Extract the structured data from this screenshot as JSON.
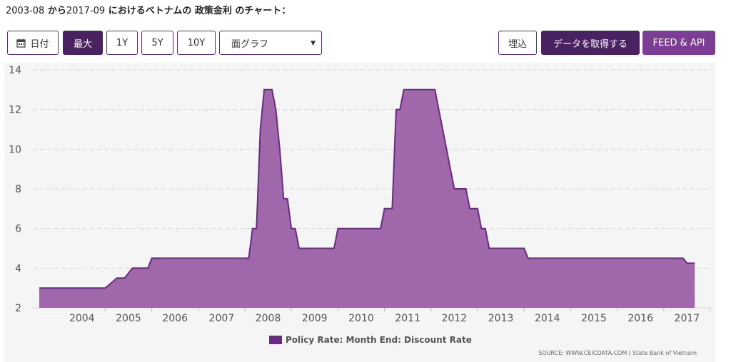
{
  "title": {
    "start": "2003-08",
    "from_word": " から",
    "end": "2017-09",
    "rest": " におけるベトナムの 政策金利 のチャート："
  },
  "toolbar": {
    "date_label": "日付",
    "max_label": "最大",
    "one_y_label": "1Y",
    "five_y_label": "5Y",
    "ten_y_label": "10Y",
    "chart_type_value": "面グラフ",
    "embed_label": "埋込",
    "get_data_label": "データを取得する",
    "feed_api_label": "FEED & API"
  },
  "colors": {
    "area_fill": "#9c5fa6",
    "area_stroke": "#6a2c80",
    "active_button": "#4a2161",
    "accent_button": "#7c3e94"
  },
  "icons": {
    "date": "calendar-icon",
    "select": "caret-down-icon"
  },
  "chart_data": {
    "type": "area",
    "title": "",
    "xlabel": "",
    "ylabel": "",
    "ylim": [
      2,
      14
    ],
    "y_ticks": [
      "2",
      "4",
      "6",
      "8",
      "10",
      "12",
      "14"
    ],
    "x_ticks": [
      "2004",
      "2005",
      "2006",
      "2007",
      "2008",
      "2009",
      "2010",
      "2011",
      "2012",
      "2013",
      "2014",
      "2015",
      "2016",
      "2017"
    ],
    "grid": true,
    "legend_position": "bottom-center",
    "series": [
      {
        "name": "Policy Rate: Month End: Discount Rate",
        "x": [
          "2003-08",
          "2004-12",
          "2005-01",
          "2005-04",
          "2005-06",
          "2005-08",
          "2005-10",
          "2005-12",
          "2006-01",
          "2007-12",
          "2008-01",
          "2008-02",
          "2008-03",
          "2008-04",
          "2008-05",
          "2008-06",
          "2008-07",
          "2008-08",
          "2008-09",
          "2008-10",
          "2008-11",
          "2008-12",
          "2009-01",
          "2009-02",
          "2009-03",
          "2009-12",
          "2010-01",
          "2010-02",
          "2010-11",
          "2010-12",
          "2011-01",
          "2011-02",
          "2011-03",
          "2011-04",
          "2011-05",
          "2011-06",
          "2011-07",
          "2011-12",
          "2012-01",
          "2012-02",
          "2012-03",
          "2012-04",
          "2012-05",
          "2012-06",
          "2012-07",
          "2012-08",
          "2012-09",
          "2012-10",
          "2012-11",
          "2012-12",
          "2013-01",
          "2013-02",
          "2013-03",
          "2013-04",
          "2013-05",
          "2013-06",
          "2013-07",
          "2014-01",
          "2014-02",
          "2014-03",
          "2014-04",
          "2017-06",
          "2017-07",
          "2017-09"
        ],
        "values": [
          3,
          3,
          3,
          3.5,
          3.5,
          4,
          4,
          4,
          4.5,
          4.5,
          4.5,
          4.5,
          6,
          6,
          11,
          13,
          13,
          13,
          12,
          10,
          7.5,
          7.5,
          6,
          6,
          5,
          5,
          6,
          6,
          6,
          6,
          7,
          7,
          7,
          12,
          12,
          13,
          13,
          13,
          13,
          13,
          12,
          11,
          10,
          9,
          8,
          8,
          8,
          8,
          7,
          7,
          7,
          6,
          6,
          5,
          5,
          5,
          5,
          5,
          4.5,
          4.5,
          4.5,
          4.5,
          4.25,
          4.25
        ]
      }
    ],
    "source": "SOURCE: WWW.CEICDATA.COM | State Bank of Vietnam"
  }
}
